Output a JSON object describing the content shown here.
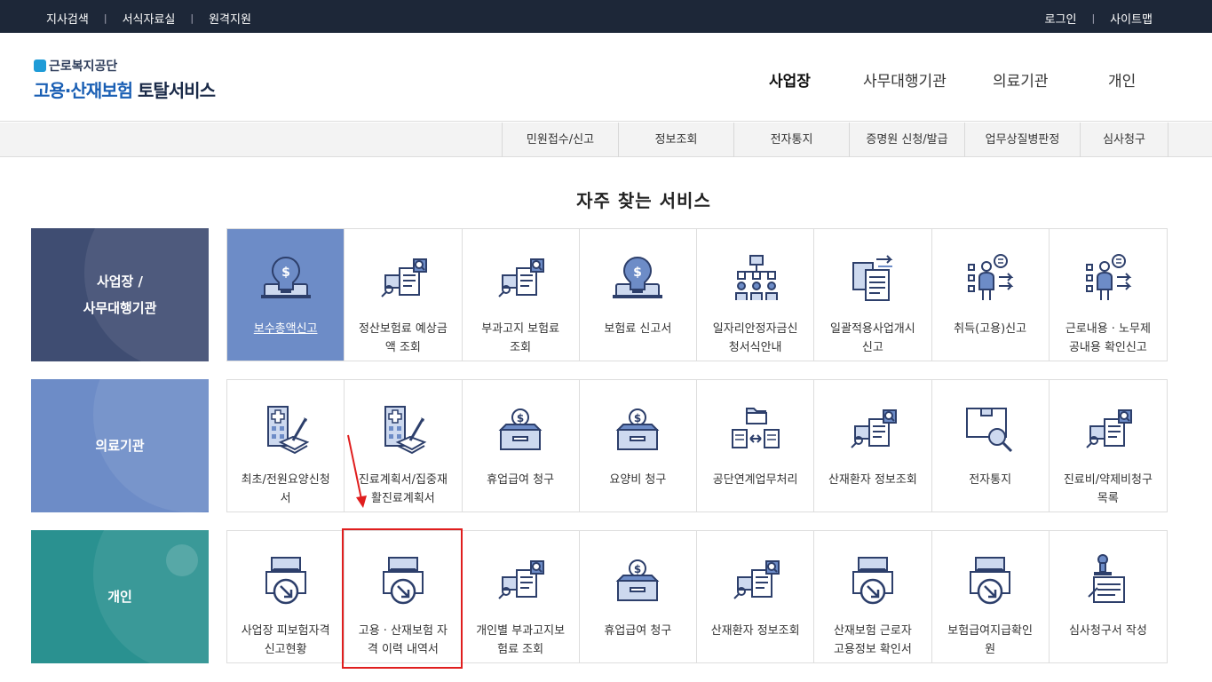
{
  "topbar": {
    "left_links": [
      "지사검색",
      "서식자료실",
      "원격지원"
    ],
    "right_links": [
      "로그인",
      "사이트맵"
    ],
    "separator": "|"
  },
  "logo": {
    "org": "근로복지공단",
    "service_highlight": "고용·산재보험",
    "service_rest": " 토탈서비스"
  },
  "main_nav": [
    "사업장",
    "사무대행기관",
    "의료기관",
    "개인"
  ],
  "sub_nav": [
    "민원접수/신고",
    "정보조회",
    "전자통지",
    "증명원 신청/발급",
    "업무상질병판정",
    "심사청구"
  ],
  "section_title": "자주 찾는 서비스",
  "categories": [
    {
      "line1": "사업장 /",
      "line2": "사무대행기관",
      "color": "#3f4d72"
    },
    {
      "line1": "의료기관",
      "line2": "",
      "color": "#6d8cc7"
    },
    {
      "line1": "개인",
      "line2": "",
      "color": "#2a9190"
    }
  ],
  "rows": [
    [
      {
        "l1": "보수총액신고",
        "l2": "",
        "icon": "money-bulb-icon"
      },
      {
        "l1": "정산보험료 예상금",
        "l2": "액 조회",
        "icon": "document-search-icon"
      },
      {
        "l1": "부과고지 보험료",
        "l2": "조회",
        "icon": "document-search-icon"
      },
      {
        "l1": "보험료 신고서",
        "l2": "",
        "icon": "money-bulb-icon"
      },
      {
        "l1": "일자리안정자금신",
        "l2": "청서식안내",
        "icon": "org-chart-people-icon"
      },
      {
        "l1": "일괄적용사업개시",
        "l2": "신고",
        "icon": "documents-transfer-icon"
      },
      {
        "l1": "취득(고용)신고",
        "l2": "",
        "icon": "person-list-icon"
      },
      {
        "l1": "근로내용 · 노무제",
        "l2": "공내용 확인신고",
        "icon": "person-list-icon"
      }
    ],
    [
      {
        "l1": "최초/전원요양신청",
        "l2": "서",
        "icon": "hospital-pen-icon"
      },
      {
        "l1": "진료계획서/집중재",
        "l2": "활진료계획서",
        "icon": "hospital-pen-icon"
      },
      {
        "l1": "휴업급여 청구",
        "l2": "",
        "icon": "money-box-icon"
      },
      {
        "l1": "요양비 청구",
        "l2": "",
        "icon": "money-box-icon"
      },
      {
        "l1": "공단연계업무처리",
        "l2": "",
        "icon": "folder-exchange-icon"
      },
      {
        "l1": "산재환자 정보조회",
        "l2": "",
        "icon": "document-search-icon"
      },
      {
        "l1": "전자통지",
        "l2": "",
        "icon": "box-search-icon"
      },
      {
        "l1": "진료비/약제비청구",
        "l2": "목록",
        "icon": "document-search-icon"
      }
    ],
    [
      {
        "l1": "사업장 피보험자격",
        "l2": "신고현황",
        "icon": "printer-download-icon"
      },
      {
        "l1": "고용 · 산재보험 자",
        "l2": "격 이력 내역서",
        "icon": "printer-download-icon"
      },
      {
        "l1": "개인별 부과고지보",
        "l2": "험료 조회",
        "icon": "document-search-icon"
      },
      {
        "l1": "휴업급여 청구",
        "l2": "",
        "icon": "money-box-icon"
      },
      {
        "l1": "산재환자 정보조회",
        "l2": "",
        "icon": "document-search-icon"
      },
      {
        "l1": "산재보험 근로자",
        "l2": "고용정보 확인서",
        "icon": "printer-download-icon"
      },
      {
        "l1": "보험급여지급확인",
        "l2": "원",
        "icon": "printer-download-icon"
      },
      {
        "l1": "심사청구서 작성",
        "l2": "",
        "icon": "stamp-document-icon"
      }
    ]
  ]
}
